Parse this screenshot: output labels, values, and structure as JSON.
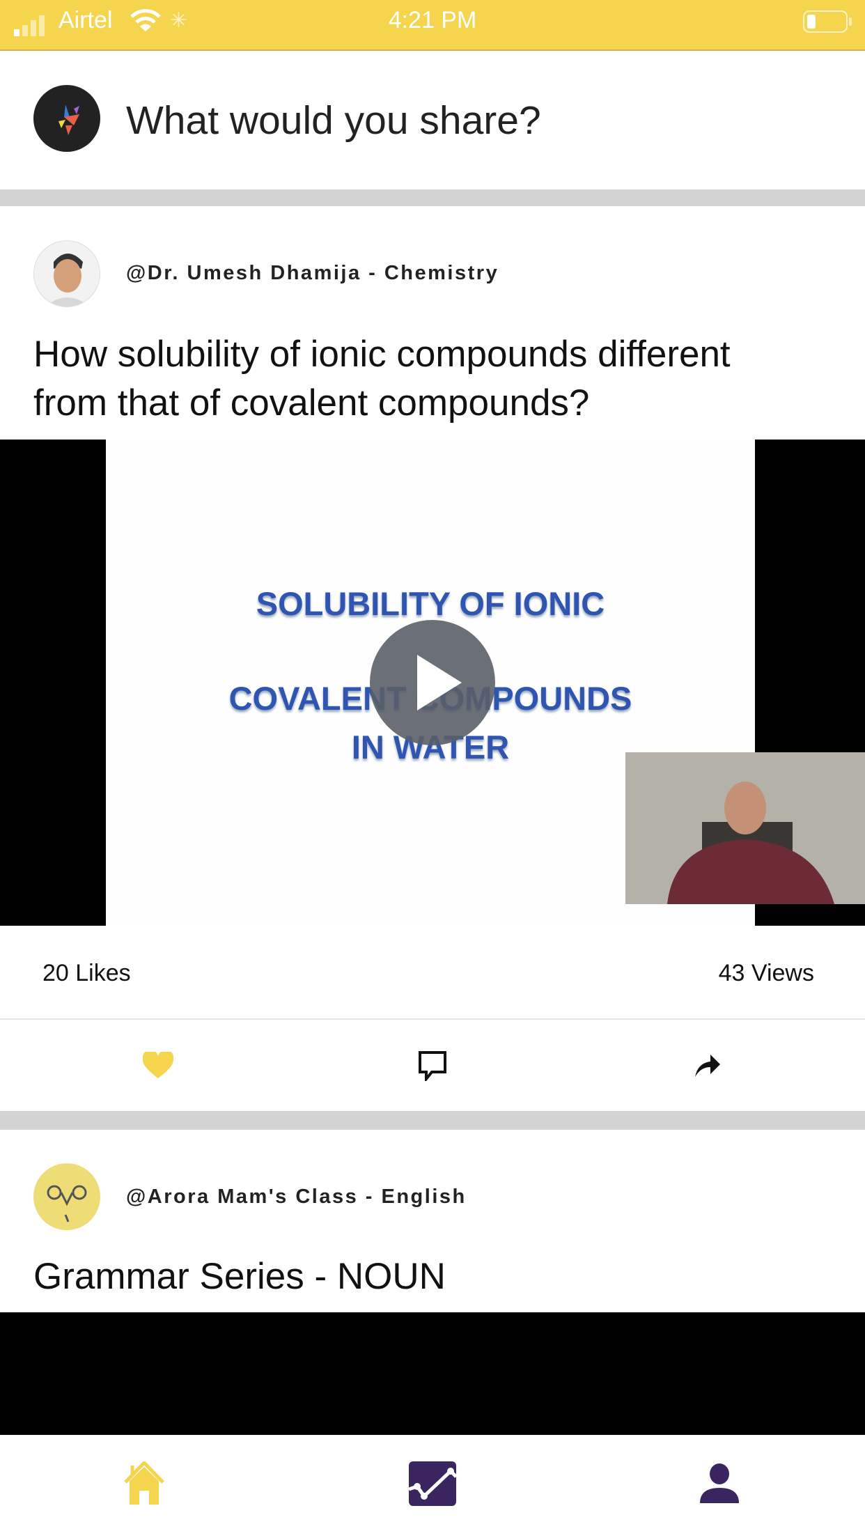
{
  "status_bar": {
    "carrier": "Airtel",
    "time": "4:21 PM"
  },
  "composer": {
    "placeholder": "What would you share?"
  },
  "posts": [
    {
      "author": "@Dr. Umesh Dhamija - Chemistry",
      "title_line1": "How solubility of ionic compounds different",
      "title_line2": "from that of covalent compounds?",
      "video": {
        "slide_line1": "SOLUBILITY OF IONIC",
        "slide_line2": "COVALENT COMPOUNDS",
        "slide_line3": "IN WATER"
      },
      "likes": "20 Likes",
      "views": "43 Views"
    },
    {
      "author": "@Arora Mam's Class  - English",
      "title_line1": "Grammar Series - NOUN"
    }
  ],
  "colors": {
    "accent": "#F5D54E",
    "nav_active": "#F5D54E",
    "nav_inactive": "#3A2560"
  },
  "tabs": [
    {
      "icon": "home-icon"
    },
    {
      "icon": "chart-icon"
    },
    {
      "icon": "profile-icon"
    }
  ]
}
